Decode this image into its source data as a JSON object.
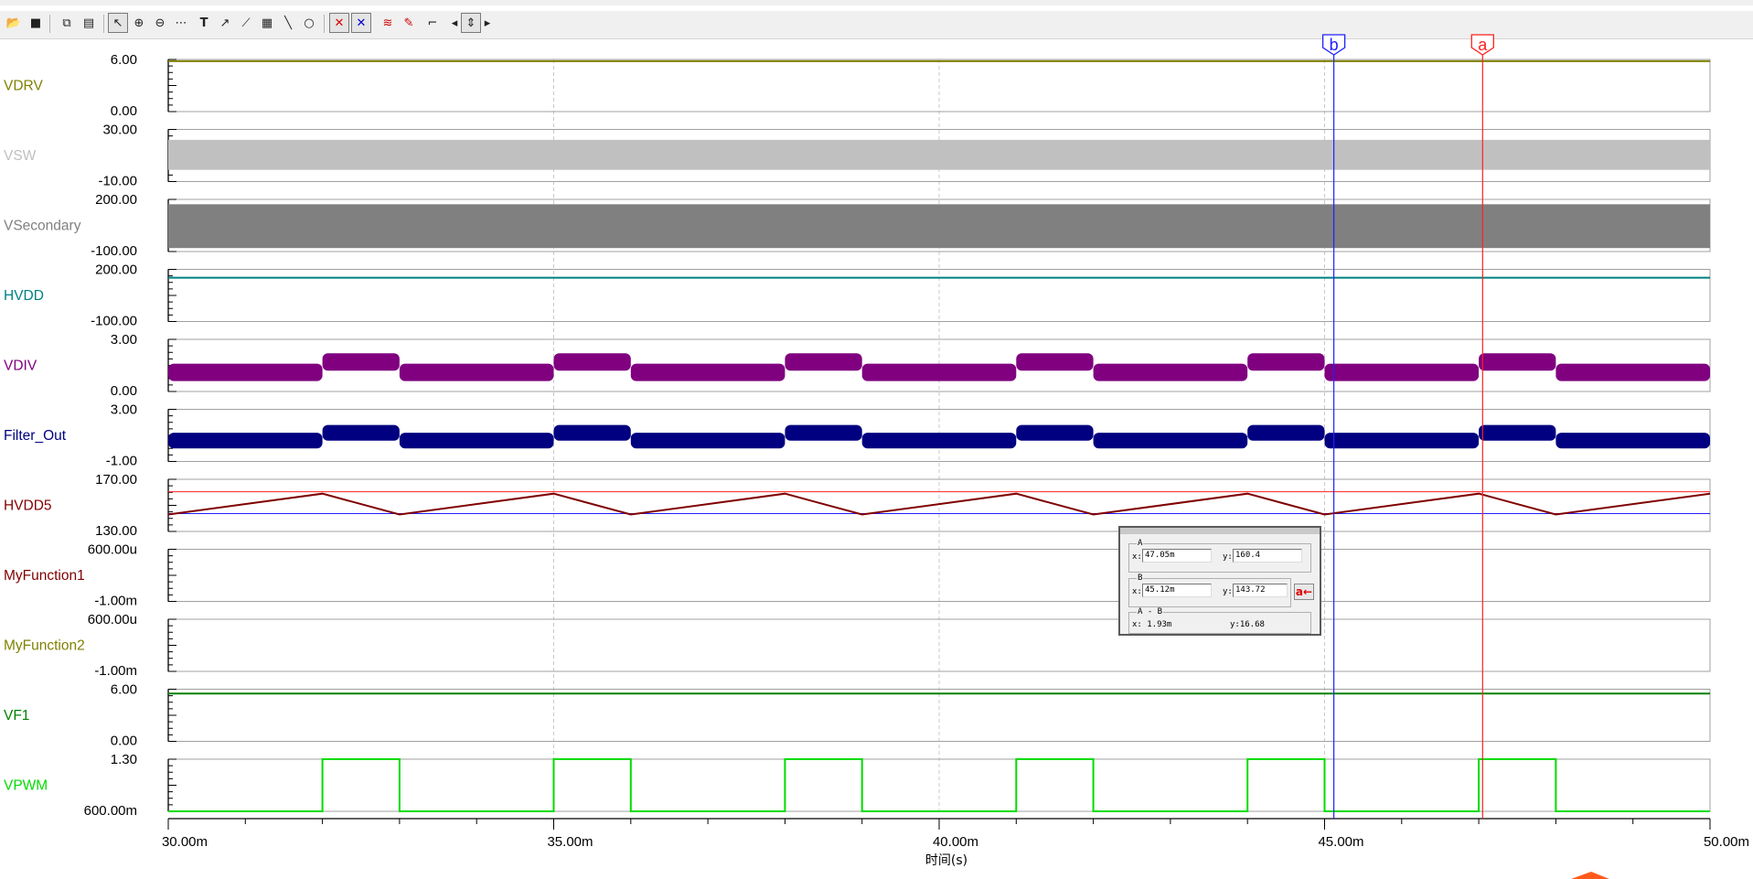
{
  "toolbar": {
    "buttons": [
      "open-icon",
      "save-icon",
      "copy-icon",
      "paste-icon",
      "pointer-icon",
      "zoom-in-icon",
      "zoom-out-icon",
      "grid-icon",
      "text-icon",
      "curve-icon",
      "measure-icon",
      "table-icon",
      "line-icon",
      "circle-icon",
      "cursor-a-icon",
      "cursor-b-icon",
      "waveform-add-icon",
      "probe-icon",
      "angle-icon",
      "scroll-left-icon",
      "scroll-updown-icon",
      "scroll-right-icon"
    ]
  },
  "colors": {
    "VDRV": "#808000",
    "VSW": "#c0c0c0",
    "VSecondary": "#808080",
    "HVDD": "#008080",
    "VDIV": "#800080",
    "Filter_Out": "#000080",
    "HVDD5": "#800000",
    "MyFunction1": "#800000",
    "MyFunction2": "#808000",
    "VF1": "#008000",
    "VPWM": "#00dd00",
    "cursor_a": "#ff2020",
    "cursor_b": "#2020ff"
  },
  "chart_data": {
    "type": "line",
    "xlabel": "时间(s)",
    "xlim": [
      30,
      50
    ],
    "x_unit": "ms",
    "x_ticks": [
      30,
      35,
      40,
      45,
      50
    ],
    "x_tick_labels": [
      "30.00m",
      "35.00m",
      "40.00m",
      "45.00m",
      "50.00m"
    ],
    "grid": true,
    "panels": [
      {
        "name": "VDRV",
        "ylim": [
          0,
          6
        ],
        "y_labels": [
          "6.00",
          "0.00"
        ],
        "kind": "flat",
        "level": 5.8
      },
      {
        "name": "VSW",
        "ylim": [
          -10,
          30
        ],
        "y_labels": [
          "30.00",
          "-10.00"
        ],
        "kind": "band",
        "lo": -1,
        "hi": 22
      },
      {
        "name": "VSecondary",
        "ylim": [
          -100,
          200
        ],
        "y_labels": [
          "200.00",
          "-100.00"
        ],
        "kind": "band",
        "lo": -80,
        "hi": 172
      },
      {
        "name": "HVDD",
        "ylim": [
          -100,
          200
        ],
        "y_labels": [
          "200.00",
          "-100.00"
        ],
        "kind": "flat",
        "level": 152
      },
      {
        "name": "VDIV",
        "ylim": [
          0,
          3
        ],
        "y_labels": [
          "3.00",
          "0.00"
        ],
        "kind": "pwmband",
        "lo_band": [
          0.6,
          1.6
        ],
        "hi_band": [
          1.2,
          2.2
        ]
      },
      {
        "name": "Filter_Out",
        "ylim": [
          -1,
          3
        ],
        "y_labels": [
          "3.00",
          "-1.00"
        ],
        "kind": "pwmband",
        "lo_band": [
          0.0,
          1.2
        ],
        "hi_band": [
          0.6,
          1.8
        ]
      },
      {
        "name": "HVDD5",
        "ylim": [
          130,
          170
        ],
        "y_labels": [
          "170.00",
          "130.00"
        ],
        "kind": "triangle",
        "x": [
          30,
          32,
          33,
          35,
          36,
          38,
          39,
          41,
          42,
          44,
          45,
          47,
          48,
          50
        ],
        "y": [
          143,
          159,
          143,
          159,
          143,
          159,
          143,
          159,
          143,
          159,
          143,
          159,
          143,
          159
        ]
      },
      {
        "name": "MyFunction1",
        "ylim": [
          -0.001,
          0.0006
        ],
        "y_labels": [
          "600.00u",
          "-1.00m"
        ],
        "kind": "none"
      },
      {
        "name": "MyFunction2",
        "ylim": [
          -0.001,
          0.0006
        ],
        "y_labels": [
          "600.00u",
          "-1.00m"
        ],
        "kind": "none"
      },
      {
        "name": "VF1",
        "ylim": [
          0,
          6
        ],
        "y_labels": [
          "6.00",
          "0.00"
        ],
        "kind": "flat",
        "level": 5.5
      },
      {
        "name": "VPWM",
        "ylim": [
          0.6,
          1.3
        ],
        "y_labels": [
          "1.30",
          "600.00m"
        ],
        "kind": "square",
        "x": [
          30,
          32,
          33,
          35,
          36,
          38,
          39,
          41,
          42,
          44,
          45,
          47,
          48,
          50
        ],
        "y": [
          0.6,
          1.3,
          0.6,
          1.3,
          0.6,
          1.3,
          0.6,
          1.3,
          0.6,
          1.3,
          0.6,
          1.3,
          0.6,
          0.6
        ]
      }
    ],
    "cursors": {
      "a": 47.05,
      "b": 45.12,
      "a_label": "a",
      "b_label": "b",
      "hline_a": 160.4,
      "hline_b": 143.72
    }
  },
  "cursor_panel": {
    "A": {
      "label": "A",
      "x_label": "x:",
      "x": "47.05m",
      "y_label": "y:",
      "y": "160.4"
    },
    "B": {
      "label": "B",
      "x_label": "x:",
      "x": "45.12m",
      "y_label": "y:",
      "y": "143.72"
    },
    "diff": {
      "label": "A - B",
      "x": "x: 1.93m",
      "y": "y:16.68"
    },
    "swap_label": "a←"
  }
}
